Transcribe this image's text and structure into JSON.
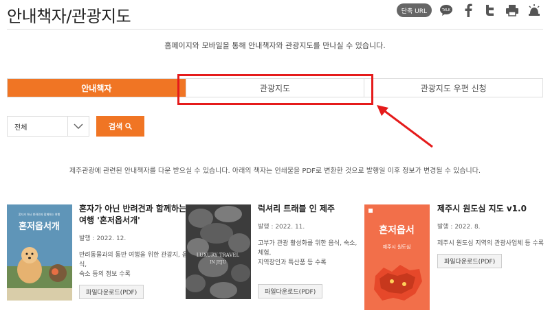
{
  "header": {
    "title": "안내책자/관광지도",
    "url_button": "단축 URL",
    "talk_label": "TALK"
  },
  "intro": "홈페이지와 모바일을 통해 안내책자와 관광지도를 만나실 수 있습니다.",
  "tabs": [
    {
      "label": "안내책자",
      "active": true
    },
    {
      "label": "관광지도",
      "active": false
    },
    {
      "label": "관광지도 우편 신청",
      "active": false
    }
  ],
  "search": {
    "select_value": "전체",
    "button_label": "검색"
  },
  "notice": "제주관광에 관련된 안내책자를 다운 받으실 수 있습니다. 아래의 책자는 인쇄물을 PDF로 변환한 것으로 발행일 이후 정보가 변경될 수 있습니다.",
  "books": [
    {
      "title_line1": "혼자가 아닌 반려견과 함께하는",
      "title_line2": "여행 '혼저옵서개'",
      "date": "발행 : 2022. 12.",
      "desc_line1": "반려동물과의 동반 여행을 위한 관광지, 음식,",
      "desc_line2": "숙소 등의 정보 수록",
      "download": "파일다운로드(PDF)",
      "cover_text": "혼저옵서개",
      "cover_small": "혼자가 아닌 반려견과 함께하는 여행"
    },
    {
      "title_line1": "럭셔리 트래블 인 제주",
      "title_line2": "",
      "date": "발행 : 2022. 11.",
      "desc_line1": "고부가 관광 활성화를 위한 음식, 숙소, 체험,",
      "desc_line2": "지역장인과 특산품 등 수록",
      "download": "파일다운로드(PDF)",
      "cover_text": "LUXURY TRAVEL",
      "cover_small": "IN JEJU"
    },
    {
      "title_line1": "제주시 원도심 지도 v1.0",
      "title_line2": "",
      "date": "발행 : 2022. 8.",
      "desc_line1": "제주시 원도심 지역의 관광사업체 등 수록",
      "desc_line2": "",
      "download": "파일다운로드(PDF)",
      "cover_text": "혼저옵서",
      "cover_small": "제주시 원도심"
    }
  ],
  "colors": {
    "accent": "#f07524",
    "highlight": "#e51b1b"
  }
}
